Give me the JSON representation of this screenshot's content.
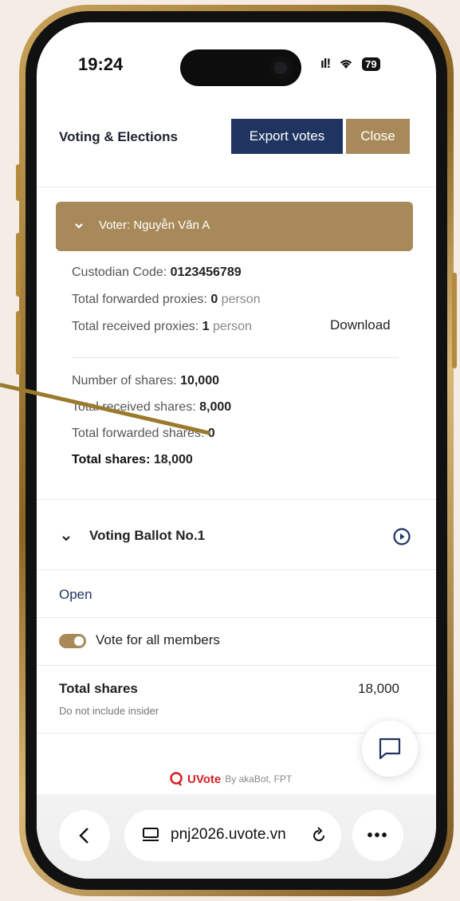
{
  "status_bar": {
    "time": "19:24",
    "battery": "79"
  },
  "header": {
    "title": "Voting & Elections",
    "export_label": "Export votes",
    "close_label": "Close"
  },
  "voter": {
    "title": "Voter: Nguyễn Văn A",
    "custodian_label": "Custodian Code:",
    "custodian_value": "0123456789",
    "forwarded_proxies_label": "Total forwarded proxies:",
    "forwarded_proxies_value": "0",
    "received_proxies_label": "Total received proxies:",
    "received_proxies_value": "1",
    "person_unit": "person",
    "download_label": "Download",
    "shares_label": "Number of shares:",
    "shares_value": "10,000",
    "received_shares_label": "Total received shares:",
    "received_shares_value": "8,000",
    "forwarded_shares_label": "Total forwarded shares:",
    "forwarded_shares_value": "0",
    "total_shares_label": "Total shares:",
    "total_shares_value": "18,000"
  },
  "ballot": {
    "title": "Voting Ballot No.1",
    "status": "Open",
    "vote_all_label": "Vote for all members",
    "total_label": "Total shares",
    "total_note": "Do not include insider",
    "total_value": "18,000"
  },
  "footer": {
    "brand": "UVote",
    "by": "By akaBot, FPT"
  },
  "browser": {
    "url": "pnj2026.uvote.vn"
  },
  "colors": {
    "primary": "#1f3460",
    "accent": "#a88a5a",
    "brand_red": "#d61f26"
  },
  "icons": [
    "chevron-down-icon",
    "play-circle-icon",
    "chat-icon",
    "back-icon",
    "tab-icon",
    "reload-icon",
    "more-icon"
  ]
}
